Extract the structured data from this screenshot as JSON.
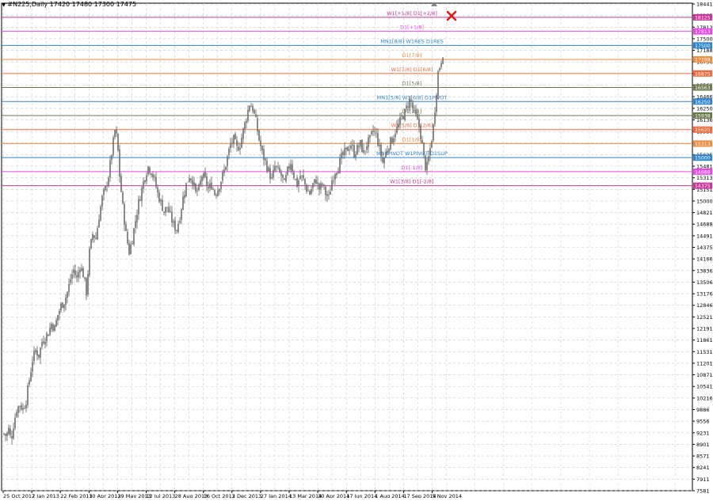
{
  "window": {
    "symbol_text": "#N225,Daily  17420 17480 17300 17475"
  },
  "colors": {
    "background": "#ffffff",
    "grid": "#c8c8c8",
    "axis": "#000000",
    "candle": "#6e6e6e",
    "marker": "#e0191a"
  },
  "chart_data": {
    "type": "candlestick",
    "title": "",
    "xlabel": "",
    "ylabel": "",
    "ylim": [
      7581,
      18441
    ],
    "grid": true,
    "y_ticks": [
      "18441",
      "18125",
      "17813",
      "17500",
      "17188",
      "16796",
      "16875",
      "16563",
      "16466",
      "16250",
      "16136",
      "15938",
      "15811",
      "15625",
      "15481",
      "15313",
      "15151",
      "15000",
      "14821",
      "14688",
      "14491",
      "14375",
      "14166",
      "13836",
      "13506",
      "13176",
      "12846",
      "12521",
      "12191",
      "11861",
      "11531",
      "11201",
      "10871",
      "10541",
      "10216",
      "9886",
      "9556",
      "9231",
      "8901",
      "8571",
      "8241",
      "7911",
      "7581"
    ],
    "x_ticks": [
      "25 Oct 2012",
      "7 Jan 2013",
      "22 Feb 2013",
      "10 Apr 2013",
      "29 May 2013",
      "12 Jul 2013",
      "28 Aug 2013",
      "16 Oct 2013",
      "2 Dec 2013",
      "27 Jan 2014",
      "13 Mar 2014",
      "30 Apr 2014",
      "17 Jun 2014",
      "1 Aug 2014",
      "17 Sep 2014",
      "5 Nov 2014"
    ],
    "levels": [
      {
        "price": 18125,
        "label": "W1[+1/8] D1[+2/8]",
        "value_label": "18125",
        "color": "#cc3399"
      },
      {
        "price": 17813,
        "label": "D1[+1/8]",
        "value_label": "17813",
        "color": "#ee44ee"
      },
      {
        "price": 17500,
        "label": "MN1[8/8] W1RES D1RES",
        "value_label": "17500",
        "color": "#2a84d2"
      },
      {
        "price": 17188,
        "label": "D1[7/8]",
        "value_label": "17188",
        "color": "#f08a3c"
      },
      {
        "price": 16875,
        "label": "W1[7/8] D1[6/8]",
        "value_label": "16875",
        "color": "#f26a3c"
      },
      {
        "price": 16563,
        "label": "D1[5/8]",
        "value_label": "16563",
        "color": "#6b7a4a"
      },
      {
        "price": 16250,
        "label": "MN1[5/8] W1[6/8] D1PIVOT",
        "value_label": "16250",
        "color": "#2a84d2"
      },
      {
        "price": 15938,
        "label": "D1[3/8]",
        "value_label": "15938",
        "color": "#6b7a4a"
      },
      {
        "price": 15625,
        "label": "W1[5/8] D1[2/8]",
        "value_label": "15625",
        "color": "#f26a3c"
      },
      {
        "price": 15313,
        "label": "D1[1/8]",
        "value_label": "15313",
        "color": "#f08a3c"
      },
      {
        "price": 15000,
        "label": "MN1PIVOT W1PIVOT D1SUP",
        "value_label": "15000",
        "color": "#2a84d2"
      },
      {
        "price": 14688,
        "label": "D1[-1/8]",
        "value_label": "14688",
        "color": "#ee44ee"
      },
      {
        "price": 14375,
        "label": "W1[3/8] D1[-2/8]",
        "value_label": "14375",
        "color": "#cc3399"
      }
    ],
    "path": [
      [
        0,
        8850
      ],
      [
        3,
        8800
      ],
      [
        6,
        8950
      ],
      [
        9,
        8700
      ],
      [
        12,
        9050
      ],
      [
        16,
        9400
      ],
      [
        20,
        9500
      ],
      [
        24,
        9400
      ],
      [
        28,
        9600
      ],
      [
        32,
        10050
      ],
      [
        36,
        10500
      ],
      [
        40,
        10700
      ],
      [
        44,
        10600
      ],
      [
        48,
        10900
      ],
      [
        52,
        11000
      ],
      [
        56,
        11100
      ],
      [
        60,
        11300
      ],
      [
        64,
        11200
      ],
      [
        68,
        11500
      ],
      [
        72,
        11700
      ],
      [
        76,
        11800
      ],
      [
        80,
        12000
      ],
      [
        84,
        12300
      ],
      [
        88,
        12500
      ],
      [
        92,
        12300
      ],
      [
        96,
        12600
      ],
      [
        100,
        12400
      ],
      [
        104,
        12000
      ],
      [
        108,
        12900
      ],
      [
        112,
        13300
      ],
      [
        116,
        13200
      ],
      [
        120,
        13700
      ],
      [
        124,
        14100
      ],
      [
        128,
        14300
      ],
      [
        132,
        14600
      ],
      [
        136,
        15100
      ],
      [
        140,
        15600
      ],
      [
        143,
        15400
      ],
      [
        146,
        14600
      ],
      [
        150,
        13900
      ],
      [
        154,
        13300
      ],
      [
        158,
        12900
      ],
      [
        162,
        13200
      ],
      [
        166,
        13600
      ],
      [
        170,
        14000
      ],
      [
        174,
        14300
      ],
      [
        178,
        14600
      ],
      [
        182,
        14800
      ],
      [
        186,
        14700
      ],
      [
        190,
        14500
      ],
      [
        194,
        14200
      ],
      [
        198,
        14000
      ],
      [
        202,
        13800
      ],
      [
        206,
        13900
      ],
      [
        210,
        13700
      ],
      [
        214,
        13500
      ],
      [
        218,
        13400
      ],
      [
        222,
        13700
      ],
      [
        226,
        14100
      ],
      [
        230,
        14400
      ],
      [
        234,
        14600
      ],
      [
        238,
        14500
      ],
      [
        242,
        14200
      ],
      [
        246,
        14300
      ],
      [
        250,
        14600
      ],
      [
        254,
        14500
      ],
      [
        258,
        14300
      ],
      [
        262,
        14400
      ],
      [
        266,
        14200
      ],
      [
        270,
        14300
      ],
      [
        274,
        14500
      ],
      [
        278,
        14700
      ],
      [
        282,
        15000
      ],
      [
        286,
        15300
      ],
      [
        290,
        15400
      ],
      [
        294,
        15200
      ],
      [
        298,
        15300
      ],
      [
        302,
        15600
      ],
      [
        306,
        15900
      ],
      [
        310,
        16200
      ],
      [
        314,
        16100
      ],
      [
        318,
        15800
      ],
      [
        322,
        15400
      ],
      [
        326,
        15100
      ],
      [
        330,
        14900
      ],
      [
        334,
        14700
      ],
      [
        338,
        14500
      ],
      [
        342,
        14800
      ],
      [
        346,
        14700
      ],
      [
        350,
        14600
      ],
      [
        354,
        14400
      ],
      [
        358,
        14700
      ],
      [
        362,
        14900
      ],
      [
        366,
        14600
      ],
      [
        370,
        14400
      ],
      [
        374,
        14600
      ],
      [
        378,
        14500
      ],
      [
        382,
        14300
      ],
      [
        386,
        14200
      ],
      [
        390,
        14400
      ],
      [
        394,
        14500
      ],
      [
        398,
        14300
      ],
      [
        402,
        14400
      ],
      [
        406,
        14200
      ],
      [
        410,
        14100
      ],
      [
        414,
        14500
      ],
      [
        418,
        14700
      ],
      [
        422,
        14800
      ],
      [
        426,
        15000
      ],
      [
        430,
        15100
      ],
      [
        434,
        15200
      ],
      [
        438,
        15300
      ],
      [
        442,
        15100
      ],
      [
        446,
        15200
      ],
      [
        450,
        15300
      ],
      [
        454,
        15100
      ],
      [
        458,
        15300
      ],
      [
        462,
        15400
      ],
      [
        466,
        15600
      ],
      [
        470,
        15500
      ],
      [
        474,
        15200
      ],
      [
        478,
        14900
      ],
      [
        482,
        15100
      ],
      [
        486,
        15300
      ],
      [
        490,
        15400
      ],
      [
        494,
        15600
      ],
      [
        498,
        15700
      ],
      [
        502,
        15900
      ],
      [
        506,
        16000
      ],
      [
        510,
        16200
      ],
      [
        513,
        16300
      ],
      [
        516,
        16100
      ],
      [
        520,
        15900
      ],
      [
        524,
        15700
      ],
      [
        527,
        15400
      ],
      [
        530,
        15000
      ],
      [
        533,
        14700
      ],
      [
        536,
        15000
      ],
      [
        539,
        15300
      ],
      [
        542,
        15700
      ],
      [
        545,
        16300
      ],
      [
        548,
        16900
      ],
      [
        551,
        17100
      ],
      [
        555,
        17420
      ]
    ]
  }
}
